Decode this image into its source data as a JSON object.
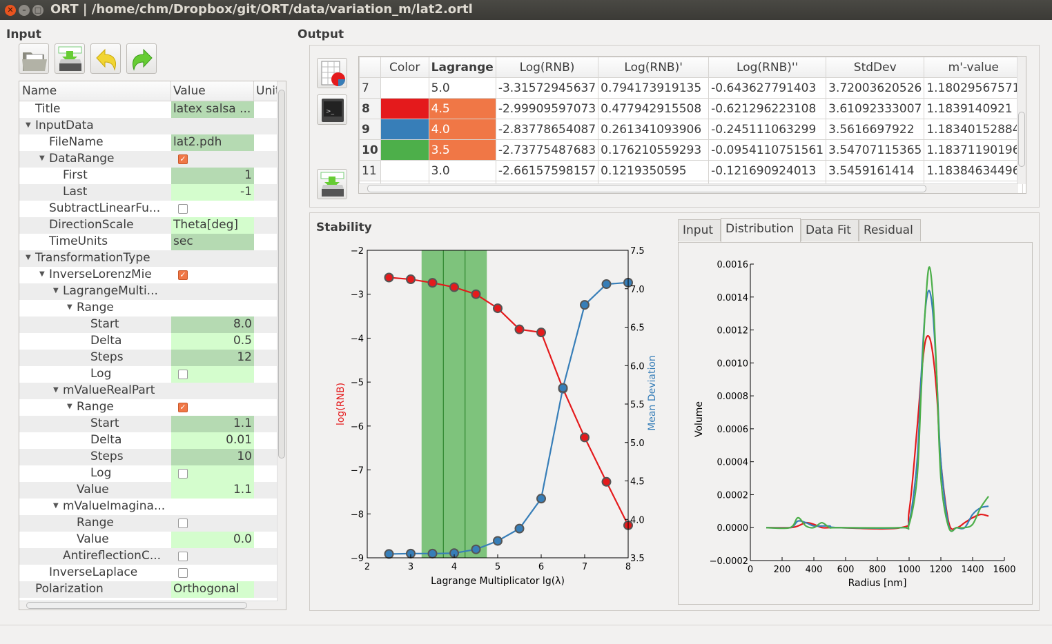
{
  "window": {
    "title": "ORT | /home/chm/Dropbox/git/ORT/data/variation_m/lat2.ortl"
  },
  "input": {
    "heading": "Input",
    "toolbar": [
      {
        "icon": "open-folder-icon"
      },
      {
        "icon": "save-disk-icon"
      },
      {
        "icon": "undo-icon"
      },
      {
        "icon": "redo-icon"
      }
    ],
    "columns": [
      "Name",
      "Value",
      "Unit"
    ],
    "rows": [
      {
        "name": "Title",
        "depth": 0,
        "value": "latex salsa ...",
        "vstyle": "dark",
        "align": "left"
      },
      {
        "name": "InputData",
        "depth": 0,
        "expander": true
      },
      {
        "name": "FileName",
        "depth": 1,
        "value": "lat2.pdh",
        "vstyle": "dark",
        "align": "left"
      },
      {
        "name": "DataRange",
        "depth": 1,
        "expander": true,
        "check": true
      },
      {
        "name": "First",
        "depth": 2,
        "value": "1",
        "vstyle": "dark",
        "align": "right"
      },
      {
        "name": "Last",
        "depth": 2,
        "value": "-1",
        "vstyle": "light",
        "align": "right"
      },
      {
        "name": "SubtractLinearFu...",
        "depth": 1,
        "check": false
      },
      {
        "name": "DirectionScale",
        "depth": 1,
        "value": "Theta[deg]",
        "vstyle": "light",
        "align": "left"
      },
      {
        "name": "TimeUnits",
        "depth": 1,
        "value": "sec",
        "vstyle": "dark",
        "align": "left"
      },
      {
        "name": "TransformationType",
        "depth": 0,
        "expander": true
      },
      {
        "name": "InverseLorenzMie",
        "depth": 1,
        "expander": true,
        "check": true
      },
      {
        "name": "LagrangeMulti...",
        "depth": 2,
        "expander": true
      },
      {
        "name": "Range",
        "depth": 3,
        "expander": true
      },
      {
        "name": "Start",
        "depth": 4,
        "value": "8.0",
        "vstyle": "dark",
        "align": "right"
      },
      {
        "name": "Delta",
        "depth": 4,
        "value": "0.5",
        "vstyle": "light",
        "align": "right"
      },
      {
        "name": "Steps",
        "depth": 4,
        "value": "12",
        "vstyle": "dark",
        "align": "right"
      },
      {
        "name": "Log",
        "depth": 4,
        "check": false,
        "vstyle": "light"
      },
      {
        "name": "mValueRealPart",
        "depth": 2,
        "expander": true
      },
      {
        "name": "Range",
        "depth": 3,
        "expander": true,
        "check": true
      },
      {
        "name": "Start",
        "depth": 4,
        "value": "1.1",
        "vstyle": "dark",
        "align": "right"
      },
      {
        "name": "Delta",
        "depth": 4,
        "value": "0.01",
        "vstyle": "light",
        "align": "right"
      },
      {
        "name": "Steps",
        "depth": 4,
        "value": "10",
        "vstyle": "dark",
        "align": "right"
      },
      {
        "name": "Log",
        "depth": 4,
        "check": false,
        "vstyle": "light"
      },
      {
        "name": "Value",
        "depth": 3,
        "value": "1.1",
        "vstyle": "light",
        "align": "right"
      },
      {
        "name": "mValueImagina...",
        "depth": 2,
        "expander": true
      },
      {
        "name": "Range",
        "depth": 3,
        "check": false
      },
      {
        "name": "Value",
        "depth": 3,
        "value": "0.0",
        "vstyle": "light",
        "align": "right"
      },
      {
        "name": "AntireflectionC...",
        "depth": 2,
        "check": false
      },
      {
        "name": "InverseLaplace",
        "depth": 1,
        "check": false
      },
      {
        "name": "Polarization",
        "depth": 0,
        "value": "Orthogonal",
        "vstyle": "light",
        "align": "left"
      }
    ]
  },
  "output": {
    "heading": "Output",
    "side_buttons": [
      {
        "icon": "table-chart-icon"
      },
      {
        "icon": "terminal-icon"
      },
      {
        "icon": "save-disk-icon"
      }
    ],
    "table": {
      "columns": [
        "",
        "Color",
        "Lagrange",
        "Log(RNB)",
        "Log(RNB)'",
        "Log(RNB)''",
        "StdDev",
        "m'-value"
      ],
      "rows": [
        {
          "id": "7",
          "color": "",
          "lagrange": "5.0",
          "cells": [
            "-3.31572945637",
            "0.794173919135",
            "-0.643627791403",
            "3.72003620526",
            "1.18029567571"
          ],
          "selected": false
        },
        {
          "id": "8",
          "color": "#e41a1c",
          "lagrange": "4.5",
          "cells": [
            "-2.99909597073",
            "0.477942915508",
            "-0.621296223108",
            "3.61092333007",
            "1.1839140921"
          ],
          "selected": true
        },
        {
          "id": "9",
          "color": "#377eb8",
          "lagrange": "4.0",
          "cells": [
            "-2.83778654087",
            "0.261341093906",
            "-0.245111063299",
            "3.5616697922",
            "1.18340152884"
          ],
          "selected": true
        },
        {
          "id": "10",
          "color": "#4daf4a",
          "lagrange": "3.5",
          "cells": [
            "-2.73775487683",
            "0.176210559293",
            "-0.0954110751561",
            "3.54707115365",
            "1.18371190196"
          ],
          "selected": true
        },
        {
          "id": "11",
          "color": "",
          "lagrange": "3.0",
          "cells": [
            "-2.66157598157",
            "0.1219350595",
            "-0.121690924013",
            "3.5459161414",
            "1.18384634496"
          ],
          "selected": false
        }
      ],
      "selected_color": "#f07746"
    }
  },
  "stability": {
    "heading": "Stability"
  },
  "tabs": [
    {
      "label": "Input"
    },
    {
      "label": "Distribution",
      "active": true
    },
    {
      "label": "Data Fit"
    },
    {
      "label": "Residual"
    }
  ],
  "chart_data": [
    {
      "type": "line",
      "xlabel": "Lagrange Multiplicator lg(λ)",
      "ylabel": "log(RNB)",
      "y2label": "Mean Deviation",
      "xlim": [
        2,
        8
      ],
      "ylim": [
        -9,
        -2
      ],
      "y2lim": [
        3.5,
        7.5
      ],
      "xticks": [
        "2",
        "3",
        "4",
        "5",
        "6",
        "7",
        "8"
      ],
      "yticks": [
        "−9",
        "−8",
        "−7",
        "−6",
        "−5",
        "−4",
        "−3",
        "−2"
      ],
      "y2ticks": [
        "3.5",
        "4.0",
        "4.5",
        "5.0",
        "5.5",
        "6.0",
        "6.5",
        "7.0",
        "7.5"
      ],
      "x": [
        2.5,
        3,
        3.5,
        4,
        4.5,
        5,
        5.5,
        6,
        6.5,
        7,
        7.5,
        8
      ],
      "series": [
        {
          "axis": "left",
          "color": "#e41a1c",
          "values": [
            -2.62,
            -2.66,
            -2.74,
            -2.84,
            -3.0,
            -3.32,
            -3.8,
            -3.87,
            -5.15,
            -6.26,
            -7.27,
            -8.26
          ]
        },
        {
          "axis": "right",
          "color": "#377eb8",
          "values": [
            3.55,
            3.555,
            3.555,
            3.56,
            3.61,
            3.72,
            3.88,
            4.27,
            5.71,
            6.79,
            7.06,
            7.08
          ]
        }
      ],
      "highlight_span": [
        3.25,
        4.75
      ],
      "highlight_lines": [
        3.75,
        4.25
      ],
      "highlight_color": "#4daf4a",
      "grid": false
    },
    {
      "type": "line",
      "xlabel": "Radius [nm]",
      "ylabel": "Volume",
      "xlim": [
        0,
        1600
      ],
      "ylim": [
        -0.0002,
        0.0016
      ],
      "xticks": [
        "0",
        "200",
        "400",
        "600",
        "800",
        "1000",
        "1200",
        "1400",
        "1600"
      ],
      "yticks": [
        "−0.0002",
        "0.0000",
        "0.0002",
        "0.0004",
        "0.0006",
        "0.0008",
        "0.0010",
        "0.0012",
        "0.0014",
        "0.0016"
      ],
      "x": [
        100,
        250,
        300,
        350,
        400,
        450,
        500,
        550,
        950,
        1000,
        1050,
        1075,
        1100,
        1125,
        1150,
        1175,
        1200,
        1250,
        1300,
        1350,
        1400,
        1450,
        1500
      ],
      "series": [
        {
          "color": "#e41a1c",
          "values": [
            0,
            0,
            1e-05,
            3e-05,
            2e-05,
            0,
            0,
            0,
            0,
            0.0001,
            0.0006,
            0.0009,
            0.00112,
            0.00116,
            0.00105,
            0.0008,
            0.0004,
            3e-05,
            0,
            3e-05,
            6e-05,
            8e-05,
            7e-05
          ]
        },
        {
          "color": "#377eb8",
          "values": [
            0,
            0,
            4e-05,
            3e-05,
            1e-05,
            1e-05,
            1e-05,
            0,
            0,
            3e-05,
            0.0004,
            0.0009,
            0.0013,
            0.00144,
            0.0013,
            0.0009,
            0.0004,
            1e-05,
            0,
            0,
            8e-05,
            0.00012,
            0.00013
          ]
        },
        {
          "color": "#4daf4a",
          "values": [
            0,
            0,
            6e-05,
            1e-05,
            0,
            3e-05,
            0,
            0,
            0,
            2e-05,
            0.0003,
            0.0008,
            0.0013,
            0.00158,
            0.0014,
            0.0009,
            0.0003,
            0,
            0,
            0,
            2e-05,
            0.00012,
            0.00019
          ]
        }
      ],
      "grid": false
    }
  ]
}
